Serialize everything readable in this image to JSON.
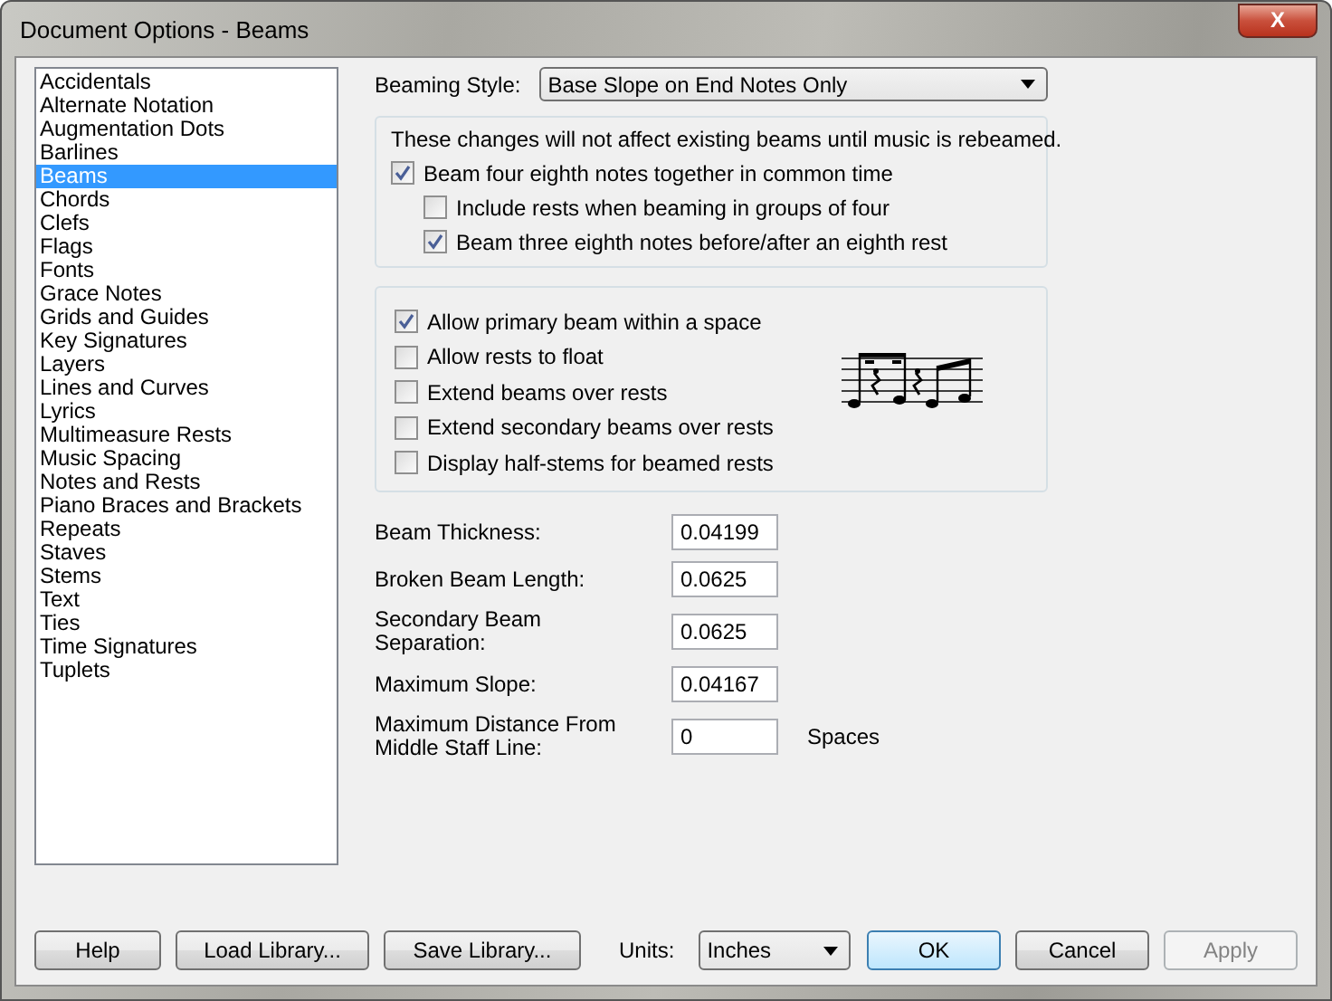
{
  "window": {
    "title": "Document Options - Beams",
    "close": "X"
  },
  "sidebar": {
    "items": [
      {
        "label": "Accidentals",
        "selected": false
      },
      {
        "label": "Alternate Notation",
        "selected": false
      },
      {
        "label": "Augmentation Dots",
        "selected": false
      },
      {
        "label": "Barlines",
        "selected": false
      },
      {
        "label": "Beams",
        "selected": true
      },
      {
        "label": "Chords",
        "selected": false
      },
      {
        "label": "Clefs",
        "selected": false
      },
      {
        "label": "Flags",
        "selected": false
      },
      {
        "label": "Fonts",
        "selected": false
      },
      {
        "label": "Grace Notes",
        "selected": false
      },
      {
        "label": "Grids and Guides",
        "selected": false
      },
      {
        "label": "Key Signatures",
        "selected": false
      },
      {
        "label": "Layers",
        "selected": false
      },
      {
        "label": "Lines and Curves",
        "selected": false
      },
      {
        "label": "Lyrics",
        "selected": false
      },
      {
        "label": "Multimeasure Rests",
        "selected": false
      },
      {
        "label": "Music Spacing",
        "selected": false
      },
      {
        "label": "Notes and Rests",
        "selected": false
      },
      {
        "label": "Piano Braces and Brackets",
        "selected": false
      },
      {
        "label": "Repeats",
        "selected": false
      },
      {
        "label": "Staves",
        "selected": false
      },
      {
        "label": "Stems",
        "selected": false
      },
      {
        "label": "Text",
        "selected": false
      },
      {
        "label": "Ties",
        "selected": false
      },
      {
        "label": "Time Signatures",
        "selected": false
      },
      {
        "label": "Tuplets",
        "selected": false
      }
    ]
  },
  "beaming_style": {
    "label": "Beaming Style:",
    "value": "Base Slope on End Notes Only"
  },
  "rebeam_group": {
    "note": "These changes will not affect existing beams until music is rebeamed.",
    "options": [
      {
        "label": "Beam four eighth notes together in common time",
        "checked": true,
        "children": [
          {
            "label": "Include rests when beaming in groups of four",
            "checked": false
          },
          {
            "label": "Beam three eighth notes before/after an eighth rest",
            "checked": true
          }
        ]
      }
    ]
  },
  "beam_group": {
    "options": [
      {
        "label": "Allow primary beam within a space",
        "checked": true
      },
      {
        "label": "Allow rests to float",
        "checked": false
      },
      {
        "label": "Extend beams over rests",
        "checked": false
      },
      {
        "label": "Extend secondary beams over rests",
        "checked": false
      },
      {
        "label": "Display half-stems for beamed rests",
        "checked": false
      }
    ]
  },
  "fields": [
    {
      "label": "Beam Thickness:",
      "value": "0.04199"
    },
    {
      "label": "Broken Beam Length:",
      "value": "0.0625"
    },
    {
      "label": "Secondary Beam Separation:",
      "value": "0.0625"
    },
    {
      "label": "Maximum Slope:",
      "value": "0.04167"
    },
    {
      "label": "Maximum Distance From Middle Staff Line:",
      "value": "0",
      "unit": "Spaces"
    }
  ],
  "footer": {
    "buttons_left": [
      {
        "label": "Help",
        "default": false,
        "disabled": false
      },
      {
        "label": "Load Library...",
        "default": false,
        "disabled": false
      },
      {
        "label": "Save Library...",
        "default": false,
        "disabled": false
      }
    ],
    "units": {
      "label": "Units:",
      "value": "Inches"
    },
    "buttons_right": [
      {
        "label": "OK",
        "default": true,
        "disabled": false
      },
      {
        "label": "Cancel",
        "default": false,
        "disabled": false
      },
      {
        "label": "Apply",
        "default": false,
        "disabled": true
      }
    ]
  }
}
